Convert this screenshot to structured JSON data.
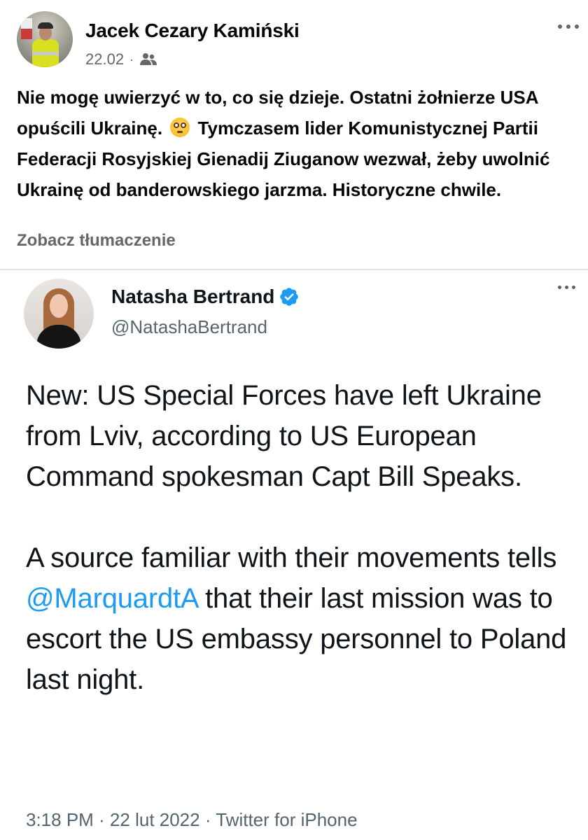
{
  "facebook_post": {
    "author": "Jacek Cezary Kamiński",
    "date": "22.02",
    "separator": "·",
    "audience_icon": "friends-icon",
    "text_part1": "Nie mogę uwierzyć w to, co się dzieje. Ostatni żołnierze USA opuścili Ukrainę.",
    "emoji": "flushed-face-emoji",
    "text_part2": "Tymczasem lider Komunistycznej Partii Federacji Rosyjskiej Gienadij Ziuganow wezwał, żeby uwolnić Ukrainę od banderowskiego jarzma. Historyczne chwile.",
    "translate_link": "Zobacz tłumaczenie"
  },
  "tweet": {
    "display_name": "Natasha Bertrand",
    "handle": "@NatashaBertrand",
    "verified_icon": "verified-badge-icon",
    "paragraph1": "New: US Special Forces have left Ukraine from Lviv, according to US European Command spokesman Capt Bill Speaks.",
    "paragraph2_before": "A source familiar with their movements tells",
    "mention": "@MarquardtA",
    "paragraph2_after": "that their last mission was to escort the US embassy personnel to Poland last night.",
    "footer": "3:18 PM · 22 lut 2022 · Twitter for iPhone"
  },
  "colors": {
    "mention": "#1d9bf0",
    "secondary_text": "#65676b",
    "tweet_secondary": "#536471",
    "verified": "#1d9bf0"
  }
}
